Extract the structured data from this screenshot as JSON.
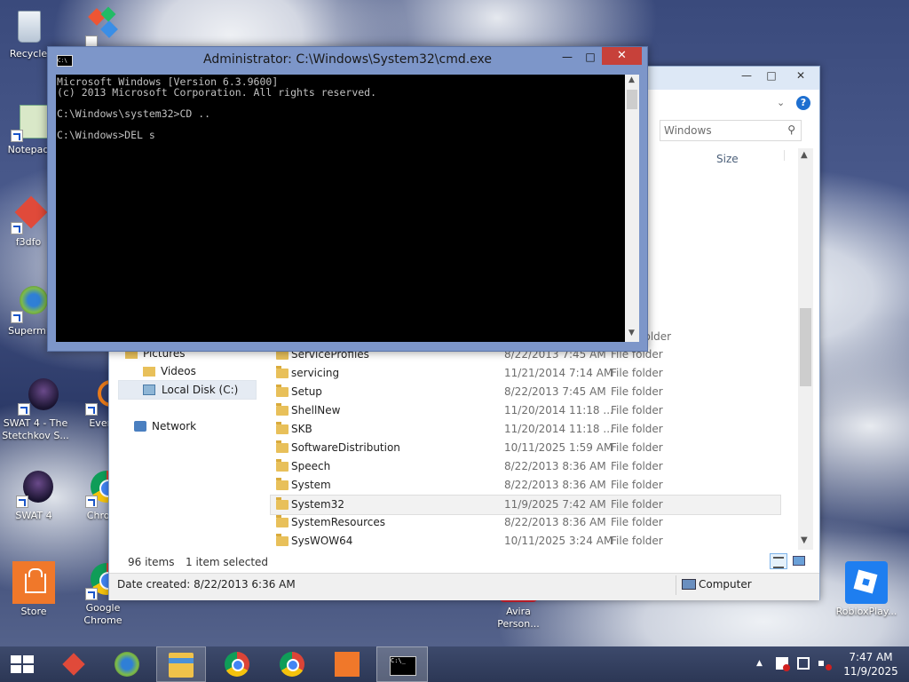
{
  "desktop": {
    "icons": [
      {
        "label": "Recycle",
        "icon": "recycle-bin-icon"
      },
      {
        "label": "Notepad",
        "icon": "notepad-icon"
      },
      {
        "label": "f3dfo",
        "icon": "app-icon"
      },
      {
        "label": "Supermi",
        "icon": "browser-icon"
      },
      {
        "label": "SWAT 4 - The Stetchkov S...",
        "icon": "game-icon"
      },
      {
        "label": "Every",
        "icon": "search-app-icon"
      },
      {
        "label": "SWAT 4",
        "icon": "game-icon"
      },
      {
        "label": "Chrom",
        "icon": "chrome-icon"
      },
      {
        "label": "Store",
        "icon": "store-icon"
      },
      {
        "label": "Google Chrome",
        "icon": "chrome-icon"
      },
      {
        "label": "Avira Person...",
        "icon": "avira-icon"
      },
      {
        "label": "RobloxPlay...",
        "icon": "roblox-icon"
      }
    ]
  },
  "cmd": {
    "title": "Administrator: C:\\Windows\\System32\\cmd.exe",
    "lines": [
      "Microsoft Windows [Version 6.3.9600]",
      "(c) 2013 Microsoft Corporation. All rights reserved.",
      "",
      "C:\\Windows\\system32>CD ..",
      "",
      "C:\\Windows>DEL s"
    ]
  },
  "explorer": {
    "search_placeholder": "Windows",
    "column_size": "Size",
    "nav": {
      "pictures": "Pictures",
      "videos": "Videos",
      "local_disk": "Local Disk (C:)",
      "network": "Network"
    },
    "rows": [
      {
        "name": "ServiceProfiles",
        "date": "8/22/2013 7:45 AM",
        "type": "File folder"
      },
      {
        "name": "servicing",
        "date": "11/21/2014 7:14 AM",
        "type": "File folder"
      },
      {
        "name": "Setup",
        "date": "8/22/2013 7:45 AM",
        "type": "File folder"
      },
      {
        "name": "ShellNew",
        "date": "11/20/2014 11:18 ...",
        "type": "File folder"
      },
      {
        "name": "SKB",
        "date": "11/20/2014 11:18 ...",
        "type": "File folder"
      },
      {
        "name": "SoftwareDistribution",
        "date": "10/11/2025 1:59 AM",
        "type": "File folder"
      },
      {
        "name": "Speech",
        "date": "8/22/2013 8:36 AM",
        "type": "File folder"
      },
      {
        "name": "System",
        "date": "8/22/2013 8:36 AM",
        "type": "File folder"
      },
      {
        "name": "System32",
        "date": "11/9/2025 7:42 AM",
        "type": "File folder"
      },
      {
        "name": "SystemResources",
        "date": "8/22/2013 8:36 AM",
        "type": "File folder"
      },
      {
        "name": "SysWOW64",
        "date": "10/11/2025 3:24 AM",
        "type": "File folder"
      }
    ],
    "hidden_type_peek": "Folder",
    "status": {
      "items": "96 items",
      "selected": "1 item selected"
    },
    "details": {
      "date_created": "Date created: 8/22/2013 6:36 AM",
      "computer": "Computer"
    }
  },
  "taskbar": {
    "time": "7:47 AM",
    "date": "11/9/2025"
  }
}
